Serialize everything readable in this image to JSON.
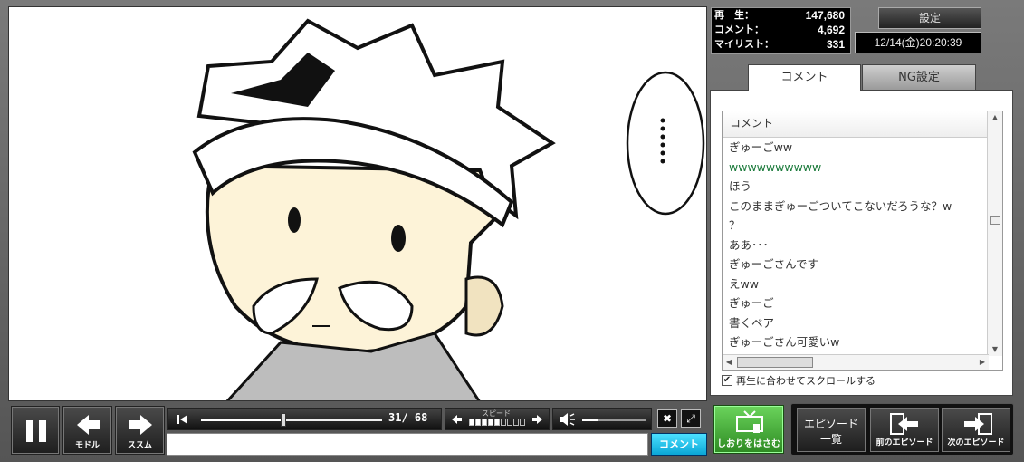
{
  "stats": {
    "play_label": "再　生：",
    "play_value": "147,680",
    "comment_label": "コメント：",
    "comment_value": "4,692",
    "mylist_label": "マイリスト：",
    "mylist_value": "331"
  },
  "header": {
    "settings_label": "設定",
    "datetime": "12/14(金)20:20:39"
  },
  "tabs": [
    {
      "label": "コメント"
    },
    {
      "label": "NG設定"
    }
  ],
  "comment_list": {
    "header": "コメント",
    "rows": [
      {
        "text": "ぎゅーごww"
      },
      {
        "text": "wwwwwwwwww"
      },
      {
        "text": "ほう"
      },
      {
        "text": "このままぎゅーごついてこないだろうな？w"
      },
      {
        "text": "？"
      },
      {
        "text": "ああ･･･"
      },
      {
        "text": "ぎゅーごさんです"
      },
      {
        "text": "えww"
      },
      {
        "text": "ぎゅーご"
      },
      {
        "text": "書くベア"
      },
      {
        "text": "ぎゅーごさん可愛いw"
      }
    ],
    "sync_label": "再生に合わせてスクロールする",
    "sync_checked": true
  },
  "controls": {
    "back_label": "モドル",
    "forward_label": "ススム",
    "time_current": "31",
    "time_total": "68",
    "speed_label": "スピード",
    "speed_level": 5,
    "speed_max": 9,
    "volume_fraction": 0.25,
    "seek_fraction": 0.456,
    "comment_button": "コメント"
  },
  "actions": {
    "bookmark_label": "しおりをはさむ",
    "episode_list_label_1": "エピソード",
    "episode_list_label_2": "一覧",
    "prev_episode_label": "前のエピソード",
    "next_episode_label": "次のエピソード"
  },
  "colors": {
    "comment_button": "#19b8e6",
    "bookmark_button": "#3ea82e",
    "green_comment": "#1a7a3a"
  }
}
